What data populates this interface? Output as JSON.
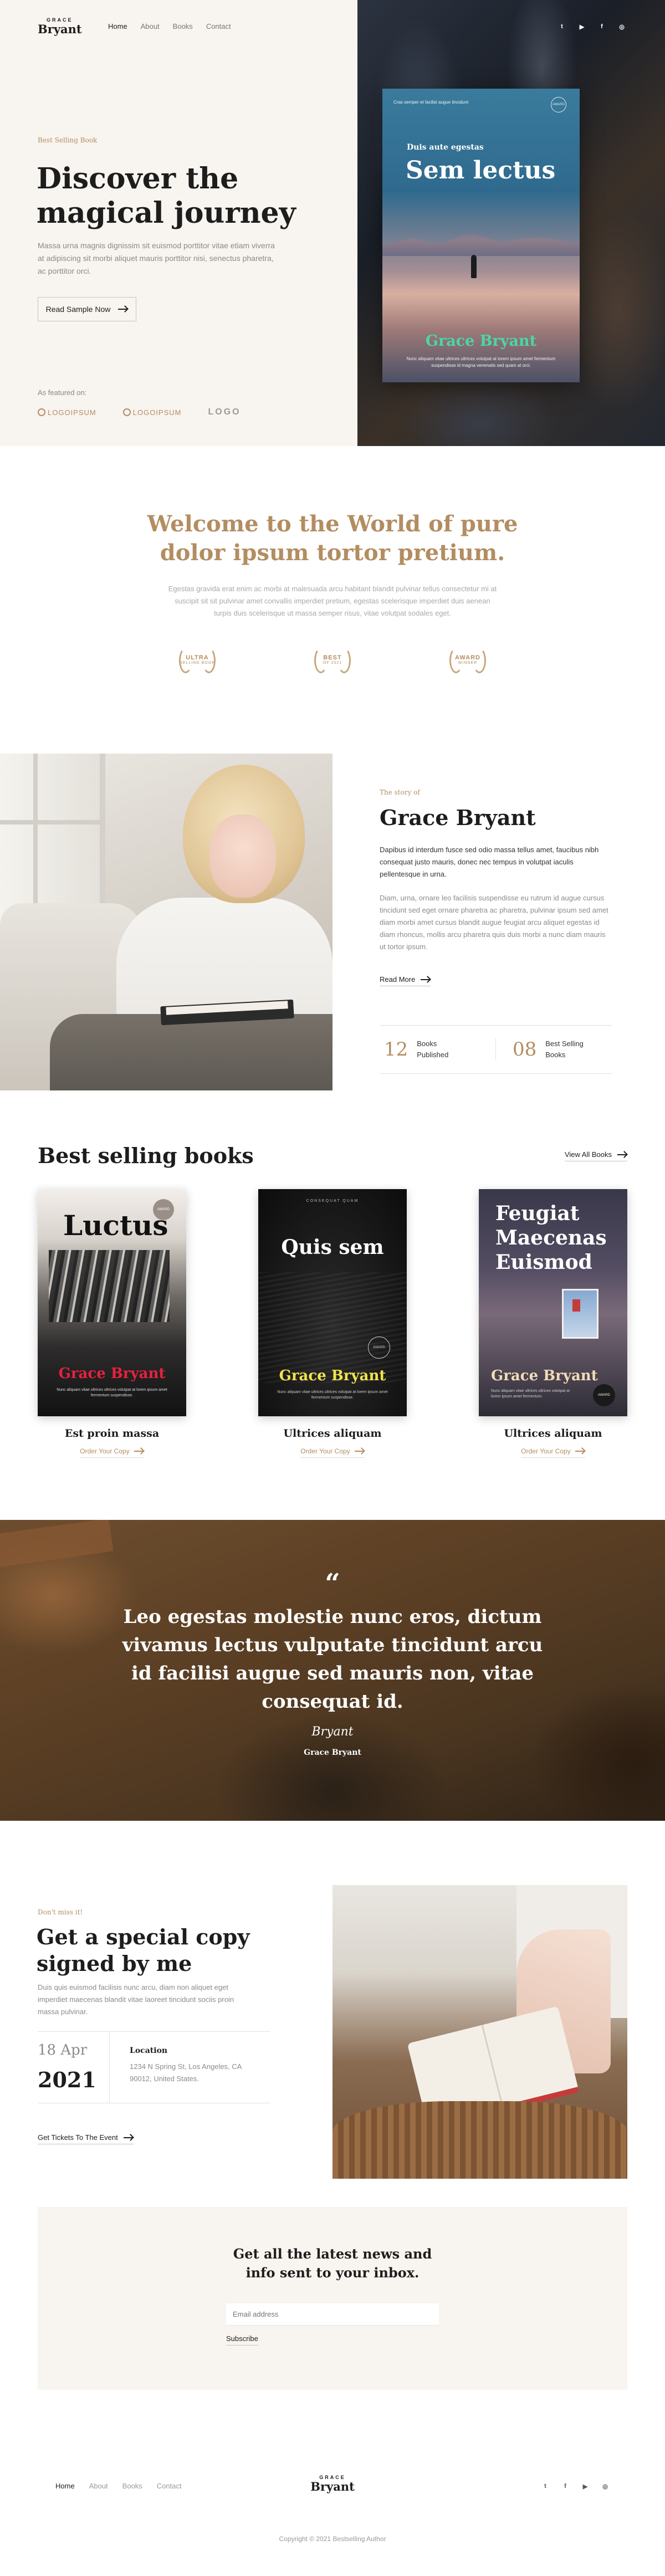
{
  "brand": {
    "small": "GRACE",
    "big": "Bryant"
  },
  "nav": [
    "Home",
    "About",
    "Books",
    "Contact"
  ],
  "social_icons": [
    "twitter-icon",
    "youtube-icon",
    "facebook-icon",
    "instagram-icon"
  ],
  "hero": {
    "eyebrow": "Best Selling Book",
    "title": "Discover the magical journey",
    "text": "Massa urna magnis dignissim sit euismod porttitor vitae etiam viverra at adipiscing sit morbi aliquet mauris porttitor nisi, senectus pharetra, ac porttitor orci.",
    "button": "Read Sample Now",
    "featured_label": "As featured on:",
    "logos": [
      "LOGOIPSUM",
      "LOGOIPSUM",
      "LOGO"
    ],
    "book": {
      "top_text": "Cras semper et facilisi augue tincidunt",
      "seal": "AWARD",
      "subtitle": "Duis aute egestas",
      "title": "Sem lectus",
      "author": "Grace Bryant",
      "blurb": "Nunc aliquam vitae ultrices ultrices volutpat at lorem ipsum amet fermentum suspendisse id magna venenatis sed quam at orci."
    }
  },
  "welcome": {
    "title": "Welcome to the World of pure dolor ipsum tortor pretium.",
    "text": "Egestas gravida erat enim ac morbi at malesuada arcu habitant blandit pulvinar tellus consectetur mi at suscipit sit sit pulvinar amet convallis imperdiet pretium, egestas scelerisque imperdiet duis aenean turpis duis scelerisque ut massa semper risus, vitae volutpat sodales eget.",
    "awards": [
      {
        "line1": "ULTRA",
        "line2": "SELLING BOOK"
      },
      {
        "line1": "BEST",
        "line2": "OF 2021"
      },
      {
        "line1": "AWARD",
        "line2": "WINNER"
      }
    ]
  },
  "about": {
    "eyebrow": "The story of",
    "title": "Grace Bryant",
    "p1": "Dapibus id interdum fusce sed odio massa tellus amet, faucibus nibh consequat justo mauris, donec nec tempus in volutpat iaculis pellentesque in urna.",
    "p2": "Diam, urna, ornare leo facilisis suspendisse eu rutrum id augue cursus tincidunt sed eget ornare pharetra ac pharetra, pulvinar ipsum sed amet diam morbi amet cursus blandit augue feugiat arcu aliquet egestas id diam rhoncus, mollis arcu pharetra quis duis morbi a nunc diam mauris ut tortor ipsum.",
    "link": "Read More",
    "stats": [
      {
        "num": "12",
        "label": "Books Published"
      },
      {
        "num": "08",
        "label": "Best Selling Books"
      }
    ]
  },
  "books": {
    "title": "Best selling books",
    "view_all": "View All Books",
    "order_label": "Order Your Copy",
    "items": [
      {
        "name": "Est proin massa",
        "cover_title": "Luctus",
        "cover_author": "Grace Bryant",
        "cover_small": "",
        "seal": "AWARD",
        "blurb": "Nunc aliquam vitae ultrices ultrices volutpat at lorem ipsum amet fermentum suspendisse."
      },
      {
        "name": "Ultrices aliquam",
        "cover_title": "Quis sem",
        "cover_author": "Grace Bryant",
        "cover_small": "CONSEQUAT QUAM",
        "seal": "AWARD",
        "blurb": "Nunc aliquam vitae ultrices ultrices volutpat at lorem ipsum amet fermentum suspendisse."
      },
      {
        "name": "Ultrices aliquam",
        "cover_title": "Feugiat Maecenas Euismod",
        "cover_author": "Grace Bryant",
        "cover_small": "",
        "seal": "AWARD",
        "blurb": "Nunc aliquam vitae ultrices ultrices volutpat at lorem ipsum amet fermentum."
      }
    ]
  },
  "quote": {
    "mark": "“",
    "text": "Leo egestas molestie nunc eros, dictum vivamus lectus vulputate tincidunt arcu id facilisi augue sed mauris non, vitae consequat id.",
    "signature": "Bryant",
    "name": "Grace Bryant"
  },
  "signed": {
    "eyebrow": "Don't miss it!",
    "title": "Get a special copy signed by me",
    "text": "Duis quis euismod facilisis nunc arcu, diam non aliquet eget imperdiet maecenas blandit vitae laoreet tincidunt sociis proin massa pulvinar.",
    "day": "18 Apr",
    "year": "2021",
    "location_label": "Location",
    "address": "1234 N Spring St, Los Angeles, CA 90012, United States.",
    "link": "Get Tickets To The Event"
  },
  "newsletter": {
    "title": "Get all the latest news and info sent to your inbox.",
    "placeholder": "Email address",
    "button": "Subscribe"
  },
  "footer": {
    "copyright": "Copyright © 2021 Bestselling Author"
  }
}
